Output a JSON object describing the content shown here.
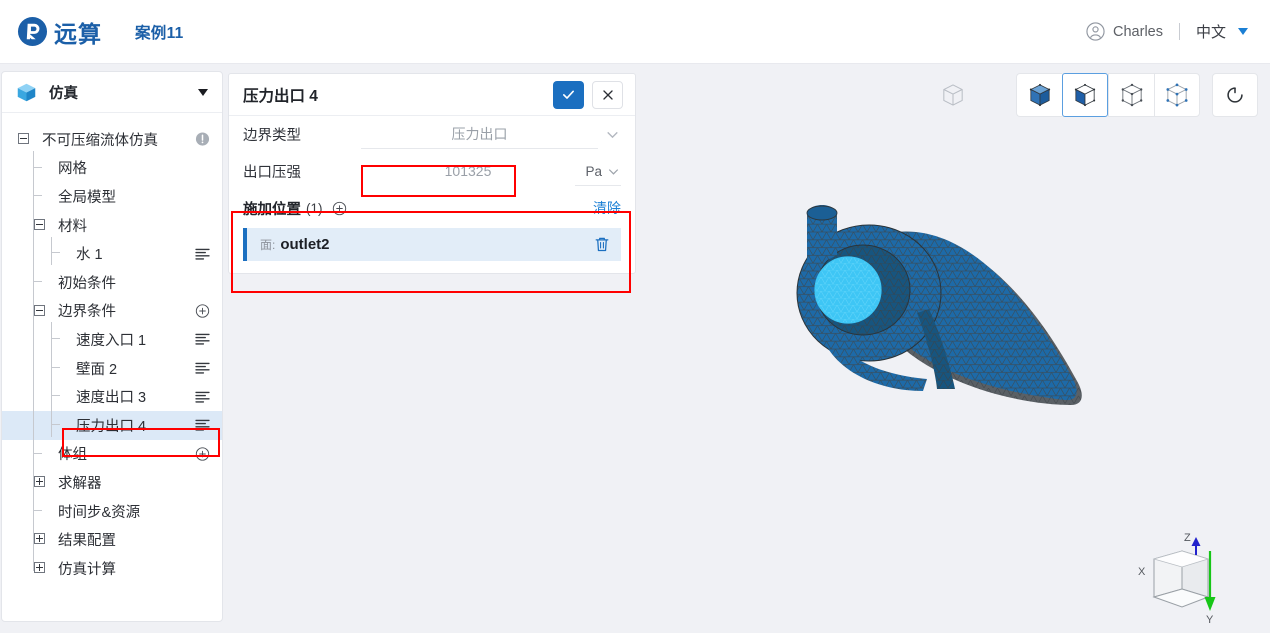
{
  "header": {
    "logo_icon": "yuansuan-logo-icon",
    "logo_text": "远算",
    "case_title": "案例11",
    "user_icon": "user-circle-icon",
    "user_name": "Charles",
    "language": "中文",
    "lang_caret_icon": "caret-down-icon"
  },
  "sidebar": {
    "header": {
      "icon": "cube-icon",
      "label": "仿真",
      "caret_icon": "caret-down-icon"
    },
    "tree": [
      {
        "label": "不可压缩流体仿真",
        "depth": 0,
        "toggle": "minus",
        "icon": "info-icon",
        "selected": false
      },
      {
        "label": "网格",
        "depth": 1,
        "toggle": "none",
        "icon": "none",
        "selected": false
      },
      {
        "label": "全局模型",
        "depth": 1,
        "toggle": "none",
        "icon": "none",
        "selected": false
      },
      {
        "label": "材料",
        "depth": 1,
        "toggle": "minus",
        "icon": "none",
        "selected": false
      },
      {
        "label": "水 1",
        "depth": 2,
        "toggle": "none",
        "icon": "list-icon",
        "selected": false
      },
      {
        "label": "初始条件",
        "depth": 1,
        "toggle": "none",
        "icon": "none",
        "selected": false
      },
      {
        "label": "边界条件",
        "depth": 1,
        "toggle": "minus",
        "icon": "plus-circle-icon",
        "selected": false
      },
      {
        "label": "速度入口 1",
        "depth": 2,
        "toggle": "none",
        "icon": "list-icon",
        "selected": false
      },
      {
        "label": "壁面 2",
        "depth": 2,
        "toggle": "none",
        "icon": "list-icon",
        "selected": false
      },
      {
        "label": "速度出口 3",
        "depth": 2,
        "toggle": "none",
        "icon": "list-icon",
        "selected": false
      },
      {
        "label": "压力出口 4",
        "depth": 2,
        "toggle": "none",
        "icon": "list-icon",
        "selected": true
      },
      {
        "label": "体组",
        "depth": 1,
        "toggle": "none",
        "icon": "plus-circle-icon",
        "selected": false
      },
      {
        "label": "求解器",
        "depth": 1,
        "toggle": "plus",
        "icon": "none",
        "selected": false
      },
      {
        "label": "时间步&资源",
        "depth": 1,
        "toggle": "none",
        "icon": "none",
        "selected": false
      },
      {
        "label": "结果配置",
        "depth": 1,
        "toggle": "plus",
        "icon": "none",
        "selected": false
      },
      {
        "label": "仿真计算",
        "depth": 1,
        "toggle": "plus",
        "icon": "none",
        "selected": false
      }
    ]
  },
  "panel": {
    "title": "压力出口 4",
    "confirm_icon": "check-icon",
    "cancel_icon": "close-icon",
    "rows": [
      {
        "label": "边界类型",
        "value": "压力出口",
        "unit": "",
        "chevron_icon": "chevron-down-icon"
      },
      {
        "label": "出口压强",
        "value": "101325",
        "unit": "Pa",
        "chevron_icon": "chevron-down-icon"
      }
    ],
    "location": {
      "title": "施加位置",
      "count": "(1)",
      "add_icon": "plus-circle-icon",
      "clear_label": "清除",
      "items": [
        {
          "kind": "面:",
          "name": "outlet2",
          "delete_icon": "trash-icon"
        }
      ]
    }
  },
  "viewport": {
    "toolbar": {
      "ghost_icon": "cube-outline-icon",
      "buttons": [
        {
          "icon": "cube-solid-icon",
          "active": false
        },
        {
          "icon": "cube-half-icon",
          "active": true
        },
        {
          "icon": "cube-wireframe-icon",
          "active": false
        },
        {
          "icon": "cube-vertices-icon",
          "active": false
        }
      ],
      "reset_icon": "reset-view-icon"
    },
    "model": {
      "name": "volute-mesh",
      "mesh_color": "#1d6aa8",
      "edge_color": "#3c4449",
      "highlight_face_color": "#3ec6f5",
      "highlight_face_name": "outlet2"
    },
    "axis_gizmo": {
      "x_label": "X",
      "y_label": "Y",
      "z_label": "Z",
      "z_color": "#2222cc",
      "y_color": "#17c617"
    }
  },
  "annotations": [
    {
      "name": "pressure-value-annotation"
    },
    {
      "name": "apply-location-annotation"
    },
    {
      "name": "tree-selected-annotation"
    }
  ]
}
